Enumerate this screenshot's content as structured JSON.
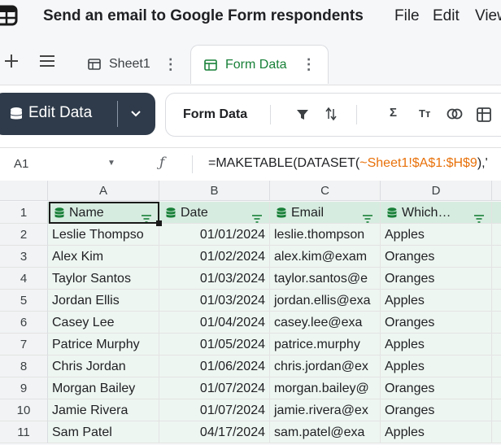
{
  "app": {
    "title": "Send an email to Google Form respondents",
    "menus": [
      "File",
      "Edit",
      "View"
    ]
  },
  "tabs": [
    {
      "label": "Sheet1",
      "icon": "table-icon",
      "active": false
    },
    {
      "label": "Form Data",
      "icon": "table-icon",
      "active": true
    }
  ],
  "toolbar": {
    "edit_label": "Edit Data",
    "table_name": "Form Data",
    "tools": [
      "filter-icon",
      "sort-icon",
      "sum-icon",
      "text-format-icon",
      "link-icon",
      "pivot-icon"
    ],
    "tool_glyphs": {
      "sum": "Σ",
      "text": "Tт"
    }
  },
  "formula_bar": {
    "cell_ref": "A1",
    "fx": "ƒ",
    "formula_prefix": "=MAKETABLE(DATASET(",
    "formula_ref": "~Sheet1!$A$1:$H$9",
    "formula_suffix": "),'"
  },
  "grid": {
    "columns": [
      "A",
      "B",
      "C",
      "D"
    ],
    "headers": [
      "Name",
      "Date",
      "Email",
      "Which…"
    ],
    "rows": [
      {
        "num": "1"
      },
      {
        "num": "2",
        "cells": [
          "Leslie Thompso",
          "01/01/2024",
          "leslie.thompson",
          "Apples"
        ]
      },
      {
        "num": "3",
        "cells": [
          "Alex Kim",
          "01/02/2024",
          "alex.kim@exam",
          "Oranges"
        ]
      },
      {
        "num": "4",
        "cells": [
          "Taylor Santos",
          "01/03/2024",
          "taylor.santos@e",
          "Oranges"
        ]
      },
      {
        "num": "5",
        "cells": [
          "Jordan Ellis",
          "01/03/2024",
          "jordan.ellis@exa",
          "Apples"
        ]
      },
      {
        "num": "6",
        "cells": [
          "Casey Lee",
          "01/04/2024",
          "casey.lee@exa",
          "Oranges"
        ]
      },
      {
        "num": "7",
        "cells": [
          "Patrice Murphy",
          "01/05/2024",
          "patrice.murphy",
          "Apples"
        ]
      },
      {
        "num": "8",
        "cells": [
          "Chris Jordan",
          "01/06/2024",
          "chris.jordan@ex",
          "Apples"
        ]
      },
      {
        "num": "9",
        "cells": [
          "Morgan Bailey",
          "01/07/2024",
          "morgan.bailey@",
          "Oranges"
        ]
      },
      {
        "num": "10",
        "cells": [
          "Jamie Rivera",
          "01/07/2024",
          "jamie.rivera@ex",
          "Oranges"
        ]
      },
      {
        "num": "11",
        "cells": [
          "Sam Patel",
          "04/17/2024",
          "sam.patel@exa",
          "Apples"
        ]
      }
    ]
  },
  "colors": {
    "accent_green": "#188038",
    "header_fill": "#d7ece0",
    "body_fill": "#eef6f1",
    "button_dark": "#2f3b4a",
    "formula_ref": "#e8710a"
  }
}
